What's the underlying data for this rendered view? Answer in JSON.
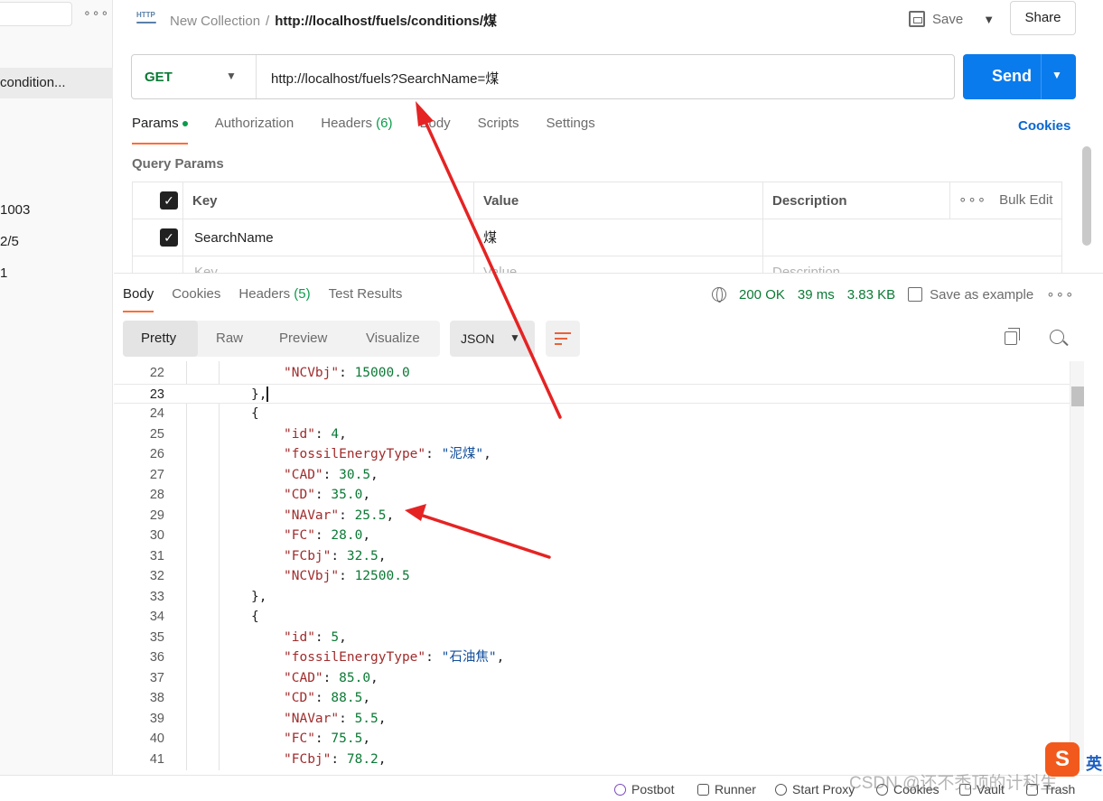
{
  "sidebar": {
    "dots": "∘∘∘",
    "active_item": "condition...",
    "values": [
      "1003",
      "2/5",
      "1"
    ]
  },
  "header": {
    "collection": "New Collection",
    "separator": "/",
    "request_name": "http://localhost/fuels/conditions/煤",
    "save_label": "Save",
    "share_label": "Share"
  },
  "request": {
    "method": "GET",
    "url": "http://localhost/fuels?SearchName=煤",
    "send_label": "Send"
  },
  "req_tabs": {
    "params": "Params",
    "authorization": "Authorization",
    "headers": "Headers",
    "headers_count": "(6)",
    "body": "Body",
    "scripts": "Scripts",
    "settings": "Settings",
    "cookies": "Cookies"
  },
  "query_params": {
    "title": "Query Params",
    "headers": {
      "key": "Key",
      "value": "Value",
      "description": "Description",
      "bulk_edit": "Bulk Edit"
    },
    "rows": [
      {
        "key": "SearchName",
        "value": "煤",
        "description": ""
      }
    ],
    "placeholder": {
      "key": "Key",
      "value": "Value",
      "description": "Description"
    }
  },
  "response": {
    "tabs": {
      "body": "Body",
      "cookies": "Cookies",
      "headers": "Headers",
      "headers_count": "(5)",
      "test_results": "Test Results"
    },
    "status": "200 OK",
    "time": "39 ms",
    "size": "3.83 KB",
    "save_example": "Save as example",
    "more": "∘∘∘",
    "views": {
      "pretty": "Pretty",
      "raw": "Raw",
      "preview": "Preview",
      "visualize": "Visualize"
    },
    "format": "JSON"
  },
  "code_lines": [
    {
      "n": "22",
      "indent": 2,
      "parts": [
        [
          "k",
          "\"NCVbj\""
        ],
        [
          "p",
          ": "
        ],
        [
          "num",
          "15000.0"
        ]
      ]
    },
    {
      "n": "23",
      "indent": 1,
      "parts": [
        [
          "p",
          "},"
        ]
      ],
      "cursor": true
    },
    {
      "n": "24",
      "indent": 1,
      "parts": [
        [
          "p",
          "{"
        ]
      ]
    },
    {
      "n": "25",
      "indent": 2,
      "parts": [
        [
          "k",
          "\"id\""
        ],
        [
          "p",
          ": "
        ],
        [
          "num",
          "4"
        ],
        [
          "p",
          ","
        ]
      ]
    },
    {
      "n": "26",
      "indent": 2,
      "parts": [
        [
          "k",
          "\"fossilEnergyType\""
        ],
        [
          "p",
          ": "
        ],
        [
          "str",
          "\"泥煤\""
        ],
        [
          "p",
          ","
        ]
      ]
    },
    {
      "n": "27",
      "indent": 2,
      "parts": [
        [
          "k",
          "\"CAD\""
        ],
        [
          "p",
          ": "
        ],
        [
          "num",
          "30.5"
        ],
        [
          "p",
          ","
        ]
      ]
    },
    {
      "n": "28",
      "indent": 2,
      "parts": [
        [
          "k",
          "\"CD\""
        ],
        [
          "p",
          ": "
        ],
        [
          "num",
          "35.0"
        ],
        [
          "p",
          ","
        ]
      ]
    },
    {
      "n": "29",
      "indent": 2,
      "parts": [
        [
          "k",
          "\"NAVar\""
        ],
        [
          "p",
          ": "
        ],
        [
          "num",
          "25.5"
        ],
        [
          "p",
          ","
        ]
      ]
    },
    {
      "n": "30",
      "indent": 2,
      "parts": [
        [
          "k",
          "\"FC\""
        ],
        [
          "p",
          ": "
        ],
        [
          "num",
          "28.0"
        ],
        [
          "p",
          ","
        ]
      ]
    },
    {
      "n": "31",
      "indent": 2,
      "parts": [
        [
          "k",
          "\"FCbj\""
        ],
        [
          "p",
          ": "
        ],
        [
          "num",
          "32.5"
        ],
        [
          "p",
          ","
        ]
      ]
    },
    {
      "n": "32",
      "indent": 2,
      "parts": [
        [
          "k",
          "\"NCVbj\""
        ],
        [
          "p",
          ": "
        ],
        [
          "num",
          "12500.5"
        ]
      ]
    },
    {
      "n": "33",
      "indent": 1,
      "parts": [
        [
          "p",
          "},"
        ]
      ]
    },
    {
      "n": "34",
      "indent": 1,
      "parts": [
        [
          "p",
          "{"
        ]
      ]
    },
    {
      "n": "35",
      "indent": 2,
      "parts": [
        [
          "k",
          "\"id\""
        ],
        [
          "p",
          ": "
        ],
        [
          "num",
          "5"
        ],
        [
          "p",
          ","
        ]
      ]
    },
    {
      "n": "36",
      "indent": 2,
      "parts": [
        [
          "k",
          "\"fossilEnergyType\""
        ],
        [
          "p",
          ": "
        ],
        [
          "str",
          "\"石油焦\""
        ],
        [
          "p",
          ","
        ]
      ]
    },
    {
      "n": "37",
      "indent": 2,
      "parts": [
        [
          "k",
          "\"CAD\""
        ],
        [
          "p",
          ": "
        ],
        [
          "num",
          "85.0"
        ],
        [
          "p",
          ","
        ]
      ]
    },
    {
      "n": "38",
      "indent": 2,
      "parts": [
        [
          "k",
          "\"CD\""
        ],
        [
          "p",
          ": "
        ],
        [
          "num",
          "88.5"
        ],
        [
          "p",
          ","
        ]
      ]
    },
    {
      "n": "39",
      "indent": 2,
      "parts": [
        [
          "k",
          "\"NAVar\""
        ],
        [
          "p",
          ": "
        ],
        [
          "num",
          "5.5"
        ],
        [
          "p",
          ","
        ]
      ]
    },
    {
      "n": "40",
      "indent": 2,
      "parts": [
        [
          "k",
          "\"FC\""
        ],
        [
          "p",
          ": "
        ],
        [
          "num",
          "75.5"
        ],
        [
          "p",
          ","
        ]
      ]
    },
    {
      "n": "41",
      "indent": 2,
      "parts": [
        [
          "k",
          "\"FCbj\""
        ],
        [
          "p",
          ": "
        ],
        [
          "num",
          "78.2"
        ],
        [
          "p",
          ","
        ]
      ]
    }
  ],
  "statusbar": {
    "postbot": "Postbot",
    "runner": "Runner",
    "start_proxy": "Start Proxy",
    "cookies": "Cookies",
    "vault": "Vault",
    "trash": "Trash"
  },
  "overlay": {
    "watermark": "CSDN @还不秃顶的计科生",
    "ime_logo": "S",
    "ime_lang": "英"
  },
  "colors": {
    "send_blue": "#097bed",
    "method_green": "#0b7a35",
    "tab_accent": "#ff6c37",
    "annotation_red": "#e52323",
    "json_key": "#a12c2c",
    "json_number": "#0b7a35",
    "json_string": "#124f9c"
  }
}
